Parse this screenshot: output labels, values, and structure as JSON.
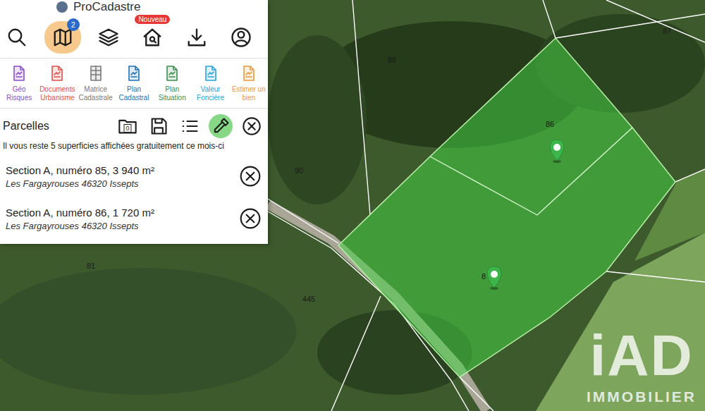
{
  "app": {
    "title": "ProCadastre"
  },
  "toolbar": [
    {
      "selected": false
    },
    {
      "selected": true,
      "badge": "2"
    },
    {
      "selected": false
    },
    {
      "selected": false,
      "tag": "Nouveau"
    },
    {
      "selected": false
    },
    {
      "selected": false
    }
  ],
  "tools": [
    {
      "label": "Géo Risques",
      "color": "#8a4fc8"
    },
    {
      "label": "Documents Urbanisme",
      "color": "#e0504a"
    },
    {
      "label": "Matrice Cadastrale",
      "color": "#7a7a7a"
    },
    {
      "label": "Plan Cadastral",
      "color": "#1f6fb5"
    },
    {
      "label": "Plan Situation",
      "color": "#3a8f4e"
    },
    {
      "label": "Valeur Foncière",
      "color": "#27a3d8"
    },
    {
      "label": "Estimer un bien",
      "color": "#e89a3a"
    }
  ],
  "parcels_panel": {
    "title": "Parcelles",
    "tools": [
      {
        "selected": false,
        "badge": "0"
      },
      {
        "selected": false
      },
      {
        "selected": false
      },
      {
        "selected": true
      },
      {
        "selected": false
      }
    ]
  },
  "notice": "Il vous reste 5 superficies affichées gratuitement ce mois-ci",
  "parcels": [
    {
      "title": "Section A, numéro 85, 3 940 m²",
      "address": "Les Fargayrouses 46320 Issepts"
    },
    {
      "title": "Section A, numéro 86, 1 720 m²",
      "address": "Les Fargayrouses 46320 Issepts"
    }
  ],
  "map": {
    "labels": [
      "87",
      "89",
      "86",
      "90",
      "81",
      "445",
      "8"
    ]
  },
  "watermark": {
    "logo": "iAD",
    "name": "IMMOBILIER"
  }
}
